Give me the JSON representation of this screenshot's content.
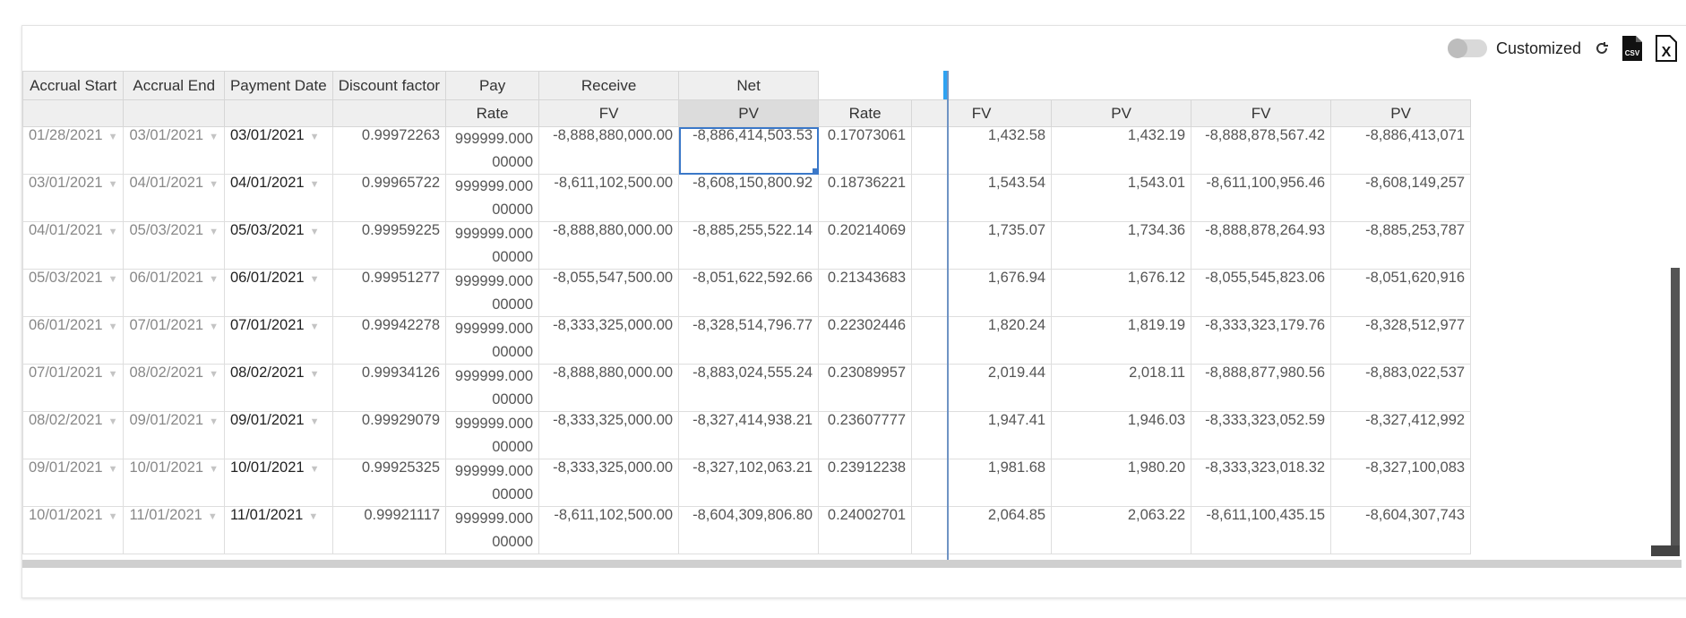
{
  "toolbar": {
    "toggle_label": "Customized",
    "refresh_icon": "refresh-icon",
    "csv_icon": "csv-file-icon",
    "csv_text": "CSV",
    "excel_icon": "excel-file-icon",
    "excel_text": "X"
  },
  "grid": {
    "group_headers": {
      "accrual_start": "Accrual Start",
      "accrual_end": "Accrual End",
      "payment_date": "Payment Date",
      "discount_factor": "Discount factor",
      "pay": "Pay",
      "receive": "Receive",
      "net": "Net"
    },
    "sub_headers": [
      "Rate",
      "FV",
      "PV",
      "Rate",
      "FV",
      "PV",
      "FV",
      "PV"
    ],
    "rows": [
      {
        "start": "01/28/2021",
        "end": "03/01/2021",
        "pay": "03/01/2021",
        "df": "0.99972263",
        "rate": "999999.00000000",
        "fv": "-8,888,880,000.00",
        "pv": "-8,886,414,503.53",
        "rate2": "0.17073061",
        "fv2": "1,432.58",
        "pv2": "1,432.19",
        "fv3": "-8,888,878,567.42",
        "pv3": "-8,886,413,071"
      },
      {
        "start": "03/01/2021",
        "end": "04/01/2021",
        "pay": "04/01/2021",
        "df": "0.99965722",
        "rate": "999999.00000000",
        "fv": "-8,611,102,500.00",
        "pv": "-8,608,150,800.92",
        "rate2": "0.18736221",
        "fv2": "1,543.54",
        "pv2": "1,543.01",
        "fv3": "-8,611,100,956.46",
        "pv3": "-8,608,149,257"
      },
      {
        "start": "04/01/2021",
        "end": "05/03/2021",
        "pay": "05/03/2021",
        "df": "0.99959225",
        "rate": "999999.00000000",
        "fv": "-8,888,880,000.00",
        "pv": "-8,885,255,522.14",
        "rate2": "0.20214069",
        "fv2": "1,735.07",
        "pv2": "1,734.36",
        "fv3": "-8,888,878,264.93",
        "pv3": "-8,885,253,787"
      },
      {
        "start": "05/03/2021",
        "end": "06/01/2021",
        "pay": "06/01/2021",
        "df": "0.99951277",
        "rate": "999999.00000000",
        "fv": "-8,055,547,500.00",
        "pv": "-8,051,622,592.66",
        "rate2": "0.21343683",
        "fv2": "1,676.94",
        "pv2": "1,676.12",
        "fv3": "-8,055,545,823.06",
        "pv3": "-8,051,620,916"
      },
      {
        "start": "06/01/2021",
        "end": "07/01/2021",
        "pay": "07/01/2021",
        "df": "0.99942278",
        "rate": "999999.00000000",
        "fv": "-8,333,325,000.00",
        "pv": "-8,328,514,796.77",
        "rate2": "0.22302446",
        "fv2": "1,820.24",
        "pv2": "1,819.19",
        "fv3": "-8,333,323,179.76",
        "pv3": "-8,328,512,977"
      },
      {
        "start": "07/01/2021",
        "end": "08/02/2021",
        "pay": "08/02/2021",
        "df": "0.99934126",
        "rate": "999999.00000000",
        "fv": "-8,888,880,000.00",
        "pv": "-8,883,024,555.24",
        "rate2": "0.23089957",
        "fv2": "2,019.44",
        "pv2": "2,018.11",
        "fv3": "-8,888,877,980.56",
        "pv3": "-8,883,022,537"
      },
      {
        "start": "08/02/2021",
        "end": "09/01/2021",
        "pay": "09/01/2021",
        "df": "0.99929079",
        "rate": "999999.00000000",
        "fv": "-8,333,325,000.00",
        "pv": "-8,327,414,938.21",
        "rate2": "0.23607777",
        "fv2": "1,947.41",
        "pv2": "1,946.03",
        "fv3": "-8,333,323,052.59",
        "pv3": "-8,327,412,992"
      },
      {
        "start": "09/01/2021",
        "end": "10/01/2021",
        "pay": "10/01/2021",
        "df": "0.99925325",
        "rate": "999999.00000000",
        "fv": "-8,333,325,000.00",
        "pv": "-8,327,102,063.21",
        "rate2": "0.23912238",
        "fv2": "1,981.68",
        "pv2": "1,980.20",
        "fv3": "-8,333,323,018.32",
        "pv3": "-8,327,100,083"
      },
      {
        "start": "10/01/2021",
        "end": "11/01/2021",
        "pay": "11/01/2021",
        "df": "0.99921117",
        "rate": "999999.00000000",
        "fv": "-8,611,102,500.00",
        "pv": "-8,604,309,806.80",
        "rate2": "0.24002701",
        "fv2": "2,064.85",
        "pv2": "2,063.22",
        "fv3": "-8,611,100,435.15",
        "pv3": "-8,604,307,743"
      }
    ]
  },
  "colors": {
    "header_bg": "#efefef",
    "selection": "#3b78c8",
    "frozen_marker": "#2ea3f2"
  }
}
